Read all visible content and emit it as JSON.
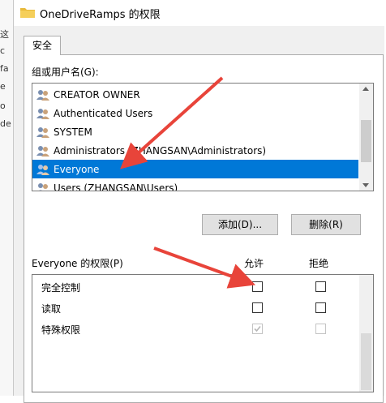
{
  "left_strip": {
    "fragments": [
      "这",
      "c",
      "fa",
      "e",
      "o",
      "de"
    ]
  },
  "window": {
    "title": "OneDriveRamps 的权限",
    "tab_label": "安全",
    "group_label": "组或用户名(G):",
    "users": [
      {
        "label": "CREATOR OWNER",
        "selected": false
      },
      {
        "label": "Authenticated Users",
        "selected": false
      },
      {
        "label": "SYSTEM",
        "selected": false
      },
      {
        "label": "Administrators (ZHANGSAN\\Administrators)",
        "selected": false
      },
      {
        "label": "Everyone",
        "selected": true
      },
      {
        "label": "Users (ZHANGSAN\\Users)",
        "selected": false
      }
    ],
    "add_button": "添加(D)...",
    "remove_button": "删除(R)",
    "perm_label": "Everyone 的权限(P)",
    "allow_header": "允许",
    "deny_header": "拒绝",
    "permissions": [
      {
        "label": "完全控制",
        "allow": false,
        "deny": false,
        "enabled": true
      },
      {
        "label": "读取",
        "allow": false,
        "deny": false,
        "enabled": true
      },
      {
        "label": "特殊权限",
        "allow": true,
        "deny": false,
        "enabled": false
      }
    ]
  },
  "colors": {
    "selection": "#0078d7",
    "arrow": "#e8443a",
    "folder": "#e8b93a"
  }
}
